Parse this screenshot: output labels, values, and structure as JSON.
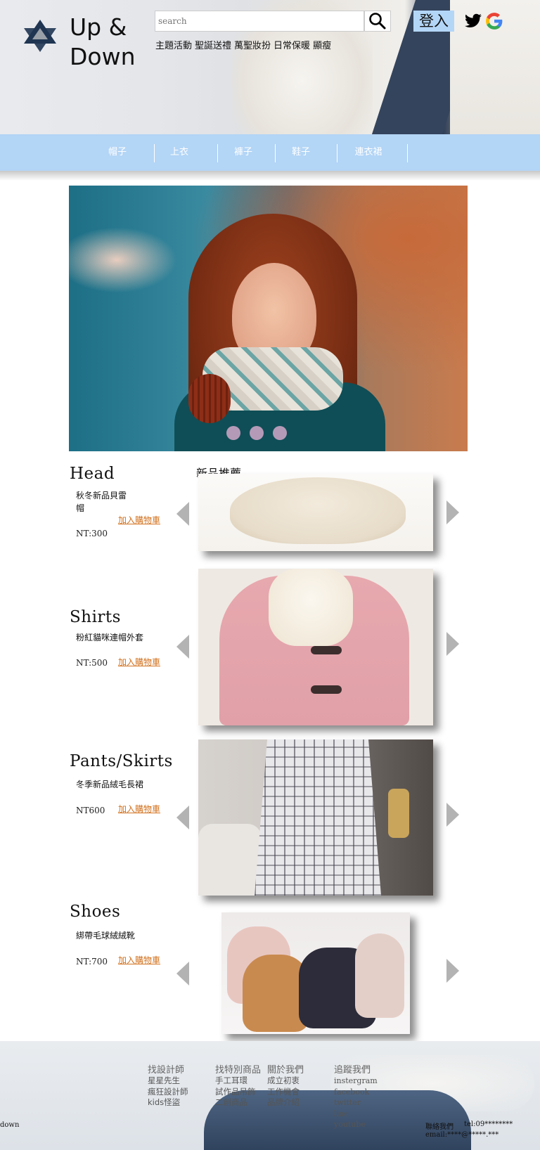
{
  "header": {
    "logo_line1": "Up &",
    "logo_line2": "Down",
    "search_placeholder": "search",
    "top_links": [
      "主題活動",
      "聖誕送禮",
      "萬聖妝扮",
      "日常保暖",
      "顯瘦"
    ],
    "login_label": "登入",
    "social_icons": [
      "twitter-icon",
      "google-icon"
    ]
  },
  "nav": {
    "items": [
      "帽子",
      "上衣",
      "褲子",
      "鞋子",
      "連衣裙"
    ]
  },
  "hero": {
    "dots": 3
  },
  "products": {
    "new_label": "新品推薦",
    "sections": [
      {
        "title": "Head",
        "name": "秋冬新品貝雷帽",
        "price": "NT:300",
        "cart": "加入購物車"
      },
      {
        "title": "Shirts",
        "name": "粉紅貓咪連帽外套",
        "price": "NT:500",
        "cart": "加入購物車"
      },
      {
        "title": "Pants/Skirts",
        "name": "冬季新品絨毛長裙",
        "price": "NT600",
        "cart": "加入購物車"
      },
      {
        "title": "Shoes",
        "name": "綁帶毛球絨絨靴",
        "price": "NT:700",
        "cart": "加入購物車"
      }
    ]
  },
  "footer": {
    "col1": {
      "heading": "找設計師",
      "items": [
        "星星先生",
        "瘋狂設計師",
        "kids怪盜"
      ]
    },
    "col2": {
      "heading": "找特別商品",
      "items": [
        "手工耳環",
        "試作品吊飾",
        "二創商品"
      ]
    },
    "col3": {
      "heading": "關於我們",
      "items": [
        "成立初衷",
        "工作機會",
        "品牌介紹"
      ]
    },
    "col4": {
      "heading": "追蹤我們",
      "items": [
        "instergram",
        "facebook",
        "twitter",
        "line",
        "youtube"
      ]
    },
    "left_text": "down",
    "contact_label": "聯絡我們",
    "tel": "tel:09********",
    "email": "email:****@*****.***"
  }
}
